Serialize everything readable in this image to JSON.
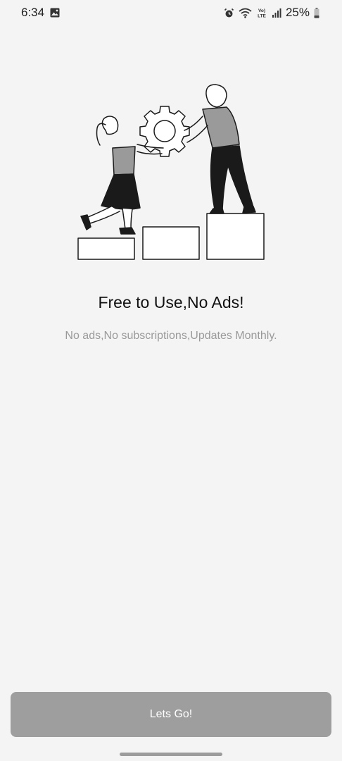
{
  "status_bar": {
    "time": "6:34",
    "battery_percent": "25%",
    "network_label": "Vo) LTE",
    "icons": [
      "image-icon",
      "alarm-icon",
      "wifi-icon",
      "volte-icon",
      "signal-icon",
      "battery-icon"
    ]
  },
  "onboarding": {
    "title": "Free to Use,No Ads!",
    "subtitle": "No ads,No subscriptions,Updates Monthly.",
    "illustration": "two-people-lifting-gear-on-steps"
  },
  "cta": {
    "label": "Lets Go!"
  },
  "colors": {
    "background": "#f4f4f4",
    "button": "#9e9e9e",
    "button_text": "#ffffff",
    "subtitle": "#9a9a9a"
  }
}
